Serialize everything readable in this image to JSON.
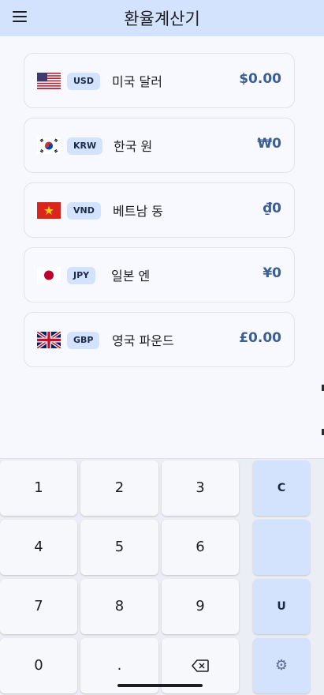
{
  "app": {
    "title": "환율계산기"
  },
  "currencies": [
    {
      "code": "USD",
      "name": "미국 달러",
      "amount": "$0.00",
      "flag": "us-flag-icon"
    },
    {
      "code": "KRW",
      "name": "한국 원",
      "amount": "₩0",
      "flag": "kr-flag-icon"
    },
    {
      "code": "VND",
      "name": "베트남 동",
      "amount": "₫0",
      "flag": "vn-flag-icon"
    },
    {
      "code": "JPY",
      "name": "일본 엔",
      "amount": "¥0",
      "flag": "jp-flag-icon"
    },
    {
      "code": "GBP",
      "name": "영국 파운드",
      "amount": "£0.00",
      "flag": "gb-flag-icon"
    }
  ],
  "keypad": {
    "digits": [
      "1",
      "2",
      "3",
      "4",
      "5",
      "6",
      "7",
      "8",
      "9",
      "0",
      "."
    ],
    "backspace_icon": "backspace-icon",
    "fn": {
      "clear": "C",
      "blank": "",
      "update": "U",
      "settings_icon": "gear-icon"
    }
  },
  "colors": {
    "appbar": "#d3e3fd",
    "background": "#f6f8fe",
    "amount": "#3c5f91",
    "badge": "#d3e3fd",
    "fn_key": "#d3e3fd"
  }
}
